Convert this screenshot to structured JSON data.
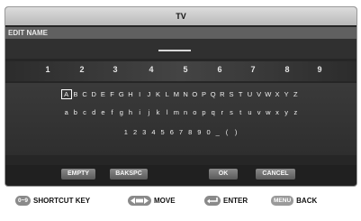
{
  "window": {
    "title": "TV",
    "section": "EDIT NAME"
  },
  "digits": [
    "1",
    "2",
    "3",
    "4",
    "5",
    "6",
    "7",
    "8",
    "9"
  ],
  "keyboard": {
    "uppercase": [
      "A",
      "B",
      "C",
      "D",
      "E",
      "F",
      "G",
      "H",
      "I",
      "J",
      "K",
      "L",
      "M",
      "N",
      "O",
      "P",
      "Q",
      "R",
      "S",
      "T",
      "U",
      "V",
      "W",
      "X",
      "Y",
      "Z"
    ],
    "lowercase": [
      "a",
      "b",
      "c",
      "d",
      "e",
      "f",
      "g",
      "h",
      "i",
      "j",
      "k",
      "l",
      "m",
      "n",
      "o",
      "p",
      "q",
      "r",
      "s",
      "t",
      "u",
      "v",
      "w",
      "x",
      "y",
      "z"
    ],
    "symbols": [
      "1",
      "2",
      "3",
      "4",
      "5",
      "6",
      "7",
      "8",
      "9",
      "0",
      "_",
      "(",
      ")"
    ],
    "selected": "A"
  },
  "buttons": {
    "empty": "EMPTY",
    "backspace": "BAKSPC",
    "ok": "OK",
    "cancel": "CANCEL"
  },
  "footer": {
    "digits_key": "0~9",
    "shortcut_label": "SHORTCUT KEY",
    "move_label": "MOVE",
    "enter_label": "ENTER",
    "menu_key": "MENU",
    "back_label": "BACK"
  }
}
